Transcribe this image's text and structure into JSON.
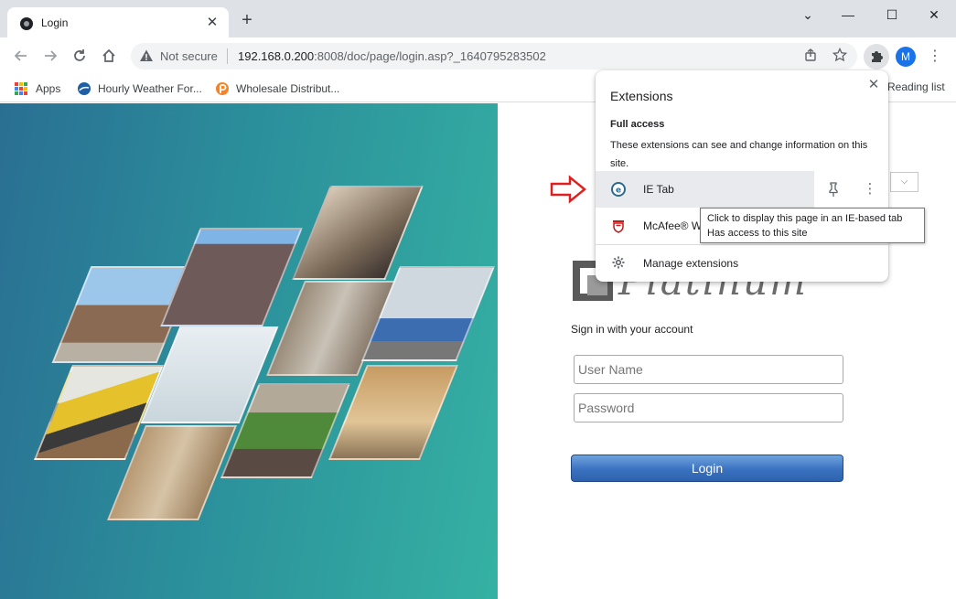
{
  "browser": {
    "tab": {
      "title": "Login",
      "close": "✕"
    },
    "new_tab": "+",
    "window_controls": {
      "minimize": "⌄",
      "restore": "—",
      "maximize": "☐",
      "close": "✕"
    },
    "address_bar": {
      "security_label": "Not secure",
      "url_host": "192.168.0.200",
      "url_rest": ":8008/doc/page/login.asp?_1640795283502"
    },
    "profile_initial": "M",
    "bookmarks": [
      {
        "label": "Apps"
      },
      {
        "label": "Hourly Weather For..."
      },
      {
        "label": "Wholesale Distribut..."
      }
    ],
    "reading_list": "Reading list"
  },
  "login": {
    "brand": "Platinum",
    "signin_text": "Sign in with your account",
    "username_placeholder": "User Name",
    "password_placeholder": "Password",
    "login_label": "Login"
  },
  "extensions_popup": {
    "title": "Extensions",
    "section_title": "Full access",
    "section_desc": "These extensions can see and change information on this site.",
    "items": [
      {
        "name": "IE Tab"
      },
      {
        "name": "McAfee® W"
      }
    ],
    "manage_label": "Manage extensions",
    "close": "✕"
  },
  "tooltip": {
    "line1": "Click to display this page in an IE-based tab",
    "line2": "Has access to this site"
  },
  "colors": {
    "accent_blue": "#1a73e8",
    "arrow_red": "#e02020",
    "login_button": "#3a72c0"
  }
}
